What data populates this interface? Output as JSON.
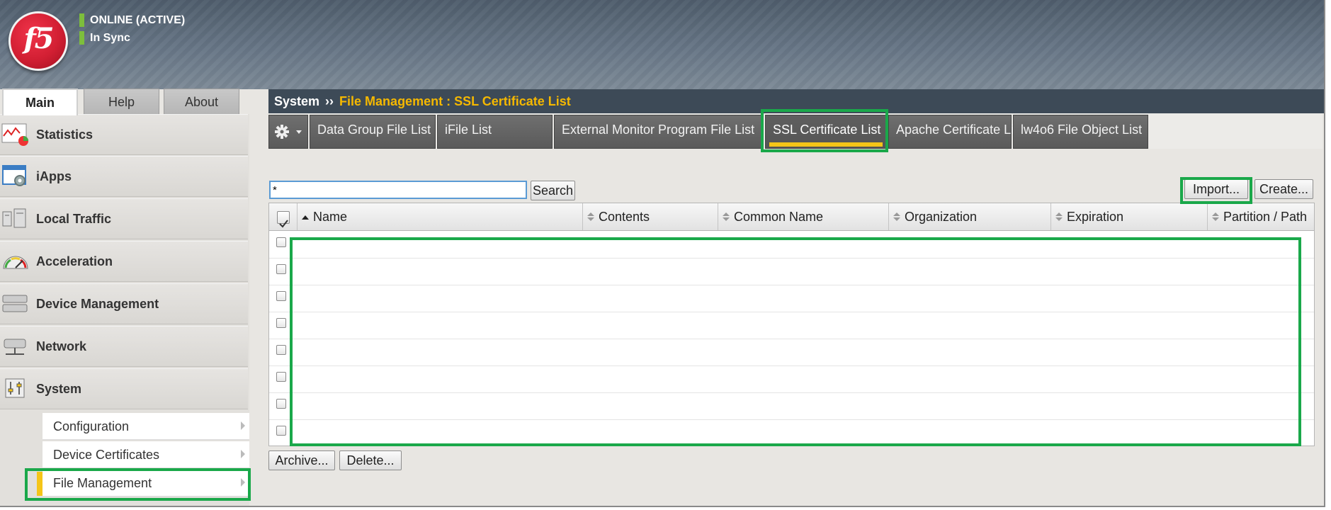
{
  "header": {
    "logo_text": "f5",
    "status_online": "ONLINE (ACTIVE)",
    "status_sync": "In Sync",
    "status_color": "#7dbe3c"
  },
  "nav_tabs": [
    "Main",
    "Help",
    "About"
  ],
  "sidebar": {
    "items": [
      {
        "label": "Statistics",
        "icon": "statistics-icon"
      },
      {
        "label": "iApps",
        "icon": "iapps-icon"
      },
      {
        "label": "Local Traffic",
        "icon": "local-traffic-icon"
      },
      {
        "label": "Acceleration",
        "icon": "acceleration-icon"
      },
      {
        "label": "Device Management",
        "icon": "device-management-icon"
      },
      {
        "label": "Network",
        "icon": "network-icon"
      },
      {
        "label": "System",
        "icon": "system-icon"
      }
    ],
    "submenu": [
      {
        "label": "Configuration"
      },
      {
        "label": "Device Certificates"
      },
      {
        "label": "File Management"
      }
    ]
  },
  "breadcrumb": {
    "root": "System",
    "separator": "››",
    "current": "File Management : SSL Certificate List"
  },
  "tabs": [
    {
      "label": "Data Group File List"
    },
    {
      "label": "iFile List"
    },
    {
      "label": "External Monitor Program File List"
    },
    {
      "label": "SSL Certificate List"
    },
    {
      "label": "Apache Certificate List"
    },
    {
      "label": "lw4o6 File Object List"
    }
  ],
  "search": {
    "value": "*",
    "button": "Search"
  },
  "actions": {
    "import": "Import...",
    "create": "Create...",
    "archive": "Archive...",
    "delete": "Delete..."
  },
  "table": {
    "columns": [
      "Name",
      "Contents",
      "Common Name",
      "Organization",
      "Expiration",
      "Partition / Path"
    ],
    "rows": 8
  },
  "colors": {
    "accent": "#f5c518",
    "highlight": "#1aa84a",
    "breadcrumb_current": "#f5b800"
  }
}
